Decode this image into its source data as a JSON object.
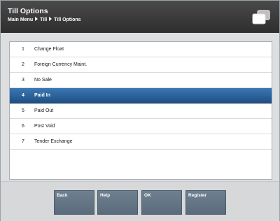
{
  "header": {
    "title": "Till Options",
    "breadcrumbs": [
      "Main Menu",
      "Till",
      "Till Options"
    ]
  },
  "menu": {
    "items": [
      {
        "num": "1",
        "label": "Change Float"
      },
      {
        "num": "2",
        "label": "Foreign Currency Maint."
      },
      {
        "num": "3",
        "label": "No Sale"
      },
      {
        "num": "4",
        "label": "Paid In"
      },
      {
        "num": "5",
        "label": "Paid Out"
      },
      {
        "num": "6",
        "label": "Post Void"
      },
      {
        "num": "7",
        "label": "Tender Exchange"
      }
    ],
    "selected": "4"
  },
  "buttons": {
    "back": "Back",
    "help": "Help",
    "ok": "OK",
    "register": "Register"
  },
  "colors": {
    "header_bg": "#3a3a3a",
    "selected_row": "#2a5f96",
    "button_bg": "#647586"
  },
  "icons": {
    "header": "till-drawer-icon",
    "breadcrumb_separator": "triangle-right-icon"
  }
}
